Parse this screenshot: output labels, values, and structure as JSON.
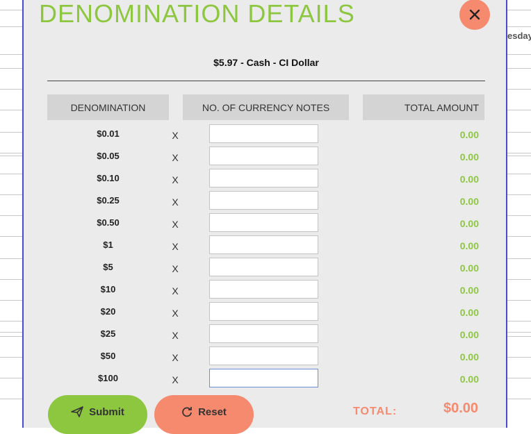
{
  "background": {
    "fragment_text": "esday"
  },
  "modal": {
    "title": "DENOMINATION DETAILS",
    "subtitle": "$5.97 - Cash - CI Dollar",
    "close_icon": "close-icon",
    "columns": {
      "denomination": "DENOMINATION",
      "notes": "NO. OF CURRENCY NOTES",
      "total": "TOTAL AMOUNT"
    },
    "times_symbol": "X",
    "rows": [
      {
        "denomination": "$0.01",
        "notes": "",
        "amount": "0.00"
      },
      {
        "denomination": "$0.05",
        "notes": "",
        "amount": "0.00"
      },
      {
        "denomination": "$0.10",
        "notes": "",
        "amount": "0.00"
      },
      {
        "denomination": "$0.25",
        "notes": "",
        "amount": "0.00"
      },
      {
        "denomination": "$0.50",
        "notes": "",
        "amount": "0.00"
      },
      {
        "denomination": "$1",
        "notes": "",
        "amount": "0.00"
      },
      {
        "denomination": "$5",
        "notes": "",
        "amount": "0.00"
      },
      {
        "denomination": "$10",
        "notes": "",
        "amount": "0.00"
      },
      {
        "denomination": "$20",
        "notes": "",
        "amount": "0.00"
      },
      {
        "denomination": "$25",
        "notes": "",
        "amount": "0.00"
      },
      {
        "denomination": "$50",
        "notes": "",
        "amount": "0.00"
      },
      {
        "denomination": "$100",
        "notes": "",
        "amount": "0.00"
      }
    ],
    "submit_label": "Submit",
    "submit_icon": "paper-plane-icon",
    "reset_label": "Reset",
    "reset_icon": "refresh-icon",
    "total_label": "TOTAL:",
    "total_value": "$0.00"
  },
  "colors": {
    "accent_green": "#8dc63f",
    "accent_salmon": "#f58a6f",
    "modal_border": "#4a4ad0"
  }
}
